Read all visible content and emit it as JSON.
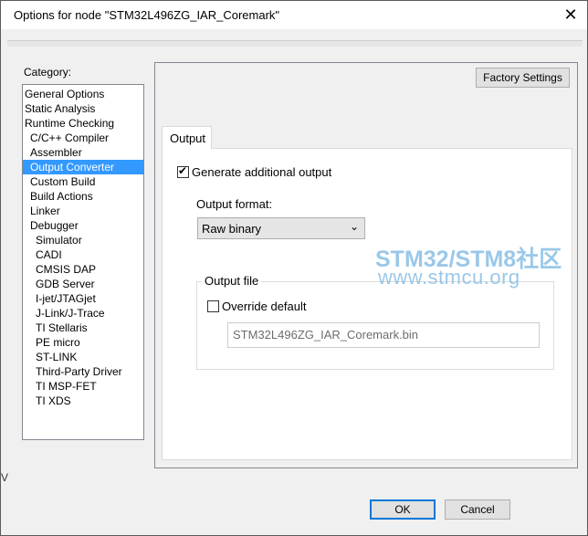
{
  "window": {
    "title": "Options for node \"STM32L496ZG_IAR_Coremark\"",
    "close_glyph": "✕"
  },
  "category": {
    "label": "Category:",
    "items": [
      {
        "label": "General Options",
        "level": 0
      },
      {
        "label": "Static Analysis",
        "level": 0
      },
      {
        "label": "Runtime Checking",
        "level": 0
      },
      {
        "label": "C/C++ Compiler",
        "level": 1
      },
      {
        "label": "Assembler",
        "level": 1
      },
      {
        "label": "Output Converter",
        "level": 1,
        "selected": true
      },
      {
        "label": "Custom Build",
        "level": 1
      },
      {
        "label": "Build Actions",
        "level": 1
      },
      {
        "label": "Linker",
        "level": 1
      },
      {
        "label": "Debugger",
        "level": 1
      },
      {
        "label": "Simulator",
        "level": 2
      },
      {
        "label": "CADI",
        "level": 2
      },
      {
        "label": "CMSIS DAP",
        "level": 2
      },
      {
        "label": "GDB Server",
        "level": 2
      },
      {
        "label": "I-jet/JTAGjet",
        "level": 2
      },
      {
        "label": "J-Link/J-Trace",
        "level": 2
      },
      {
        "label": "TI Stellaris",
        "level": 2
      },
      {
        "label": "PE micro",
        "level": 2
      },
      {
        "label": "ST-LINK",
        "level": 2
      },
      {
        "label": "Third-Party Driver",
        "level": 2
      },
      {
        "label": "TI MSP-FET",
        "level": 2
      },
      {
        "label": "TI XDS",
        "level": 2
      }
    ]
  },
  "content": {
    "factory_settings": "Factory Settings",
    "tab": "Output",
    "generate": {
      "label": "Generate additional output",
      "checked": true
    },
    "output_format": {
      "label": "Output format:",
      "value": "Raw binary"
    },
    "output_file": {
      "legend": "Output file",
      "override": {
        "label": "Override default",
        "checked": false
      },
      "filename": "STM32L496ZG_IAR_Coremark.bin"
    }
  },
  "footer": {
    "ok": "OK",
    "cancel": "Cancel"
  },
  "watermark": {
    "line1": "STM32/STM8社区",
    "line2": "www.stmcu.org"
  },
  "background_edge_text": "V",
  "colors": {
    "selection": "#3399ff",
    "ok_border": "#0078d7",
    "watermark": "#89bfe6"
  }
}
